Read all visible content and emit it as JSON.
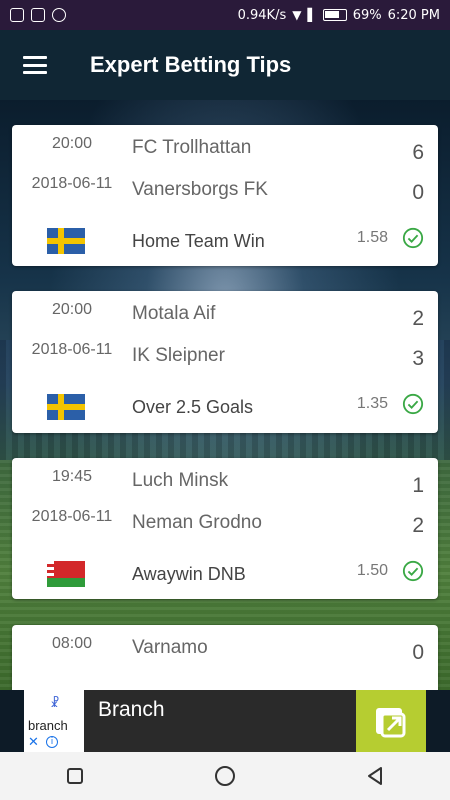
{
  "status_bar": {
    "network_speed": "0.94K/s",
    "battery": "69%",
    "time": "6:20 PM"
  },
  "app_bar": {
    "title": "Expert Betting Tips"
  },
  "tips": [
    {
      "time": "20:00",
      "date": "2018-06-11",
      "home_team": "FC Trollhattan",
      "away_team": "Vanersborgs FK",
      "home_score": "6",
      "away_score": "0",
      "flag": "sweden",
      "tip": "Home Team Win",
      "odds": "1.58",
      "status": "won"
    },
    {
      "time": "20:00",
      "date": "2018-06-11",
      "home_team": "Motala Aif",
      "away_team": "IK Sleipner",
      "home_score": "2",
      "away_score": "3",
      "flag": "sweden",
      "tip": "Over 2.5 Goals",
      "odds": "1.35",
      "status": "won"
    },
    {
      "time": "19:45",
      "date": "2018-06-11",
      "home_team": "Luch Minsk",
      "away_team": "Neman Grodno",
      "home_score": "1",
      "away_score": "2",
      "flag": "belarus",
      "tip": "Awaywin DNB",
      "odds": "1.50",
      "status": "won"
    },
    {
      "time": "08:00",
      "home_team": "Varnamo",
      "home_score": "0"
    }
  ],
  "ad": {
    "logo_text": "branch",
    "title": "Branch"
  },
  "colors": {
    "app_bar": "#102634",
    "status_bar": "#2a1a3a",
    "check_green": "#3aa845",
    "ad_action": "#b6cd31"
  }
}
